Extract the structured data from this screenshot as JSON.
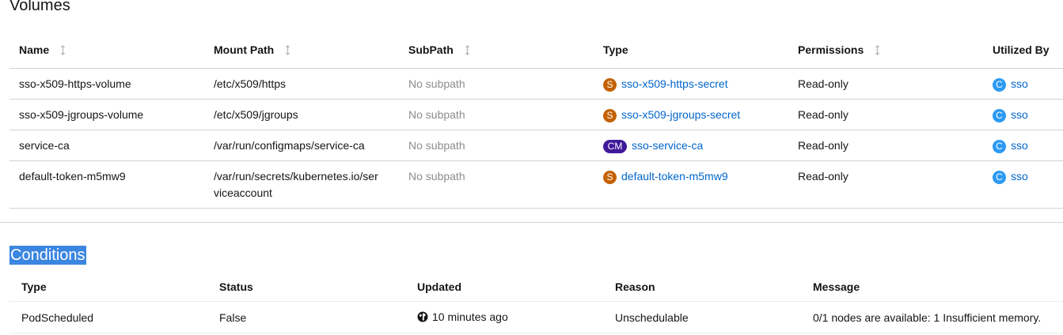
{
  "volumes": {
    "title": "Volumes",
    "columns": [
      "Name",
      "Mount Path",
      "SubPath",
      "Type",
      "Permissions",
      "Utilized By"
    ],
    "rows": [
      {
        "name": "sso-x509-https-volume",
        "mount_path": "/etc/x509/https",
        "subpath": "No subpath",
        "type_badge": "S",
        "type_link": "sso-x509-https-secret",
        "permissions": "Read-only",
        "utilized_badge": "C",
        "utilized_link": "sso"
      },
      {
        "name": "sso-x509-jgroups-volume",
        "mount_path": "/etc/x509/jgroups",
        "subpath": "No subpath",
        "type_badge": "S",
        "type_link": "sso-x509-jgroups-secret",
        "permissions": "Read-only",
        "utilized_badge": "C",
        "utilized_link": "sso"
      },
      {
        "name": "service-ca",
        "mount_path": "/var/run/configmaps/service-ca",
        "subpath": "No subpath",
        "type_badge": "CM",
        "type_link": "sso-service-ca",
        "permissions": "Read-only",
        "utilized_badge": "C",
        "utilized_link": "sso"
      },
      {
        "name": "default-token-m5mw9",
        "mount_path_line1": "/var/run/secrets/kubernetes.io/ser",
        "mount_path_line2": "viceaccount",
        "subpath": "No subpath",
        "type_badge": "S",
        "type_link": "default-token-m5mw9",
        "permissions": "Read-only",
        "utilized_badge": "C",
        "utilized_link": "sso"
      }
    ]
  },
  "conditions": {
    "title": "Conditions",
    "columns": [
      "Type",
      "Status",
      "Updated",
      "Reason",
      "Message"
    ],
    "rows": [
      {
        "type": "PodScheduled",
        "status": "False",
        "updated": "10 minutes ago",
        "reason": "Unschedulable",
        "message": "0/1 nodes are available: 1 Insufficient memory."
      }
    ]
  },
  "colors": {
    "link": "#0066cc",
    "secret_badge": "#c46100",
    "configmap_badge": "#40199a",
    "container_badge": "#2b9af3",
    "selection": "#3b86e0"
  },
  "icons": {
    "sort": "sort-icon",
    "updated": "globe-icon"
  }
}
